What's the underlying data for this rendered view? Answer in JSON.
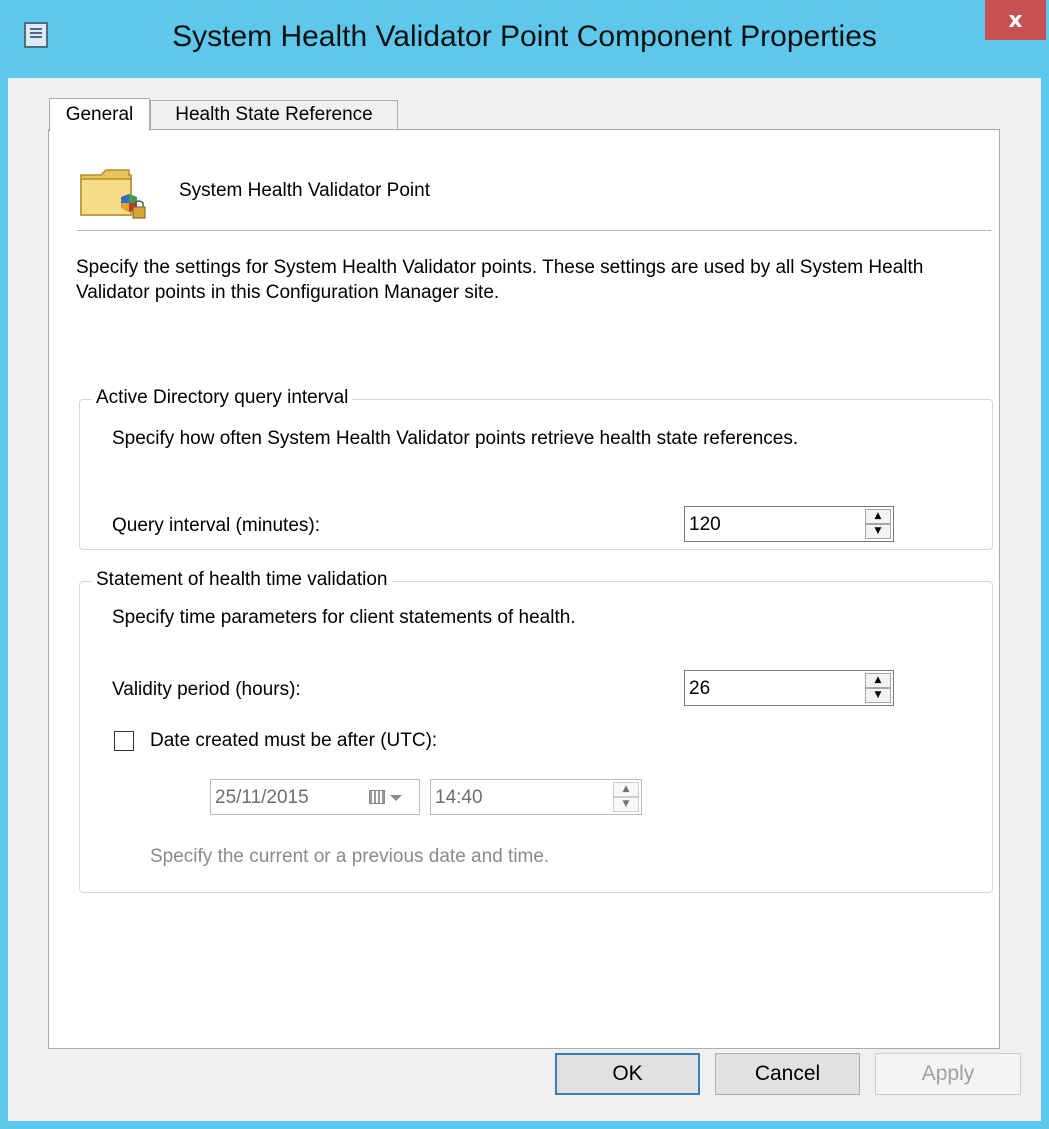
{
  "window": {
    "title": "System Health Validator Point Component Properties",
    "close_glyph": "x"
  },
  "tabs": [
    {
      "label": "General",
      "active": true
    },
    {
      "label": "Health State Reference",
      "active": false
    }
  ],
  "general": {
    "component_name": "System Health Validator Point",
    "description": "Specify the settings for System Health Validator points. These settings are used by all System Health Validator points in this Configuration Manager site.",
    "ad_group": {
      "title": "Active Directory query interval",
      "description": "Specify how often System Health Validator points retrieve health state references.",
      "query_label": "Query interval (minutes):",
      "query_value": "120"
    },
    "soh_group": {
      "title": "Statement of health time validation",
      "description": "Specify time parameters for client statements of health.",
      "validity_label": "Validity period (hours):",
      "validity_value": "26",
      "date_checkbox_label": "Date created must be after (UTC):",
      "date_checked": false,
      "date_value": "25/11/2015",
      "time_value": "14:40",
      "hint": "Specify the current or a previous date and time."
    }
  },
  "buttons": {
    "ok": "OK",
    "cancel": "Cancel",
    "apply": "Apply"
  },
  "icons": {
    "system_menu": "properties-window-icon",
    "component": "folder-shield-lock-icon",
    "spin_up": "▲",
    "spin_down": "▼"
  },
  "colors": {
    "titlebar": "#5ec8ec",
    "close_button": "#c75050",
    "default_button_border": "#3c7fb1"
  }
}
